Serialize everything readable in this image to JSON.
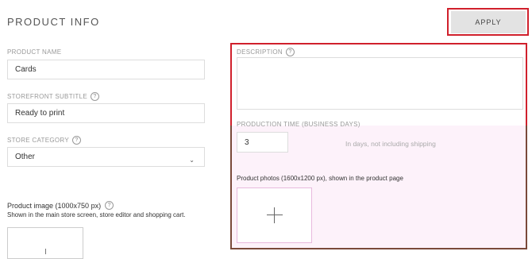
{
  "header": {
    "title": "PRODUCT INFO",
    "apply_label": "APPLY"
  },
  "product_name": {
    "label": "PRODUCT NAME",
    "value": "Cards"
  },
  "storefront_subtitle": {
    "label": "STOREFRONT SUBTITLE",
    "value": "Ready to print"
  },
  "store_category": {
    "label": "STORE CATEGORY",
    "value": "Other"
  },
  "product_image": {
    "label": "Product image (1000x750 px)",
    "subtext": "Shown in the main store screen, store editor and shopping cart."
  },
  "description": {
    "label": "DESCRIPTION",
    "value": ""
  },
  "production_time": {
    "label": "PRODUCTION TIME (BUSINESS DAYS)",
    "value": "3",
    "hint": "In days, not including shipping"
  },
  "product_photos": {
    "label": "Product photos (1600x1200 px), shown in the product page"
  },
  "colors": {
    "highlight_red": "#d0202c",
    "highlight_brown": "#7a4a3a",
    "pink_fill": "#fdf2fa"
  },
  "icons": [
    "help-icon",
    "chevron-down-icon",
    "plus-icon"
  ]
}
